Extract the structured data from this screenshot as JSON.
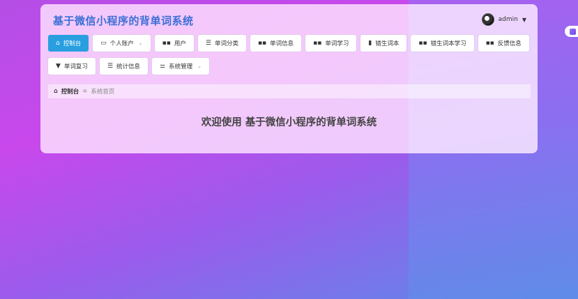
{
  "header": {
    "title": "基于微信小程序的背单词系统",
    "username": "admin",
    "caret": "▼"
  },
  "nav": {
    "row1": [
      {
        "label": "控制台",
        "icon": "home-icon",
        "active": true
      },
      {
        "label": "个人账户",
        "icon": "wallet-icon",
        "dropdown": true
      },
      {
        "label": "用户",
        "icon": "grid-icon"
      },
      {
        "label": "单词分类",
        "icon": "list-icon"
      },
      {
        "label": "单词信息",
        "icon": "grid-icon"
      },
      {
        "label": "单词学习",
        "icon": "grid-icon"
      },
      {
        "label": "错生词本",
        "icon": "bar-chart-icon"
      },
      {
        "label": "错生词本学习",
        "icon": "grid-icon"
      },
      {
        "label": "反馈信息",
        "icon": "grid-icon"
      }
    ],
    "row2": [
      {
        "label": "单词复习",
        "icon": "pin-icon"
      },
      {
        "label": "统计信息",
        "icon": "list-icon"
      },
      {
        "label": "系统管理",
        "icon": "sliders-icon",
        "dropdown": true
      }
    ]
  },
  "breadcrumb": {
    "home": "控制台",
    "separator": "≡",
    "current": "系统首页"
  },
  "main": {
    "welcome": "欢迎使用 基于微信小程序的背单词系统"
  },
  "colors": {
    "accent": "#2a9fe0",
    "title": "#3b6fd6",
    "bg_top": "#c848ec",
    "bg_bottom": "#5a8be8"
  }
}
